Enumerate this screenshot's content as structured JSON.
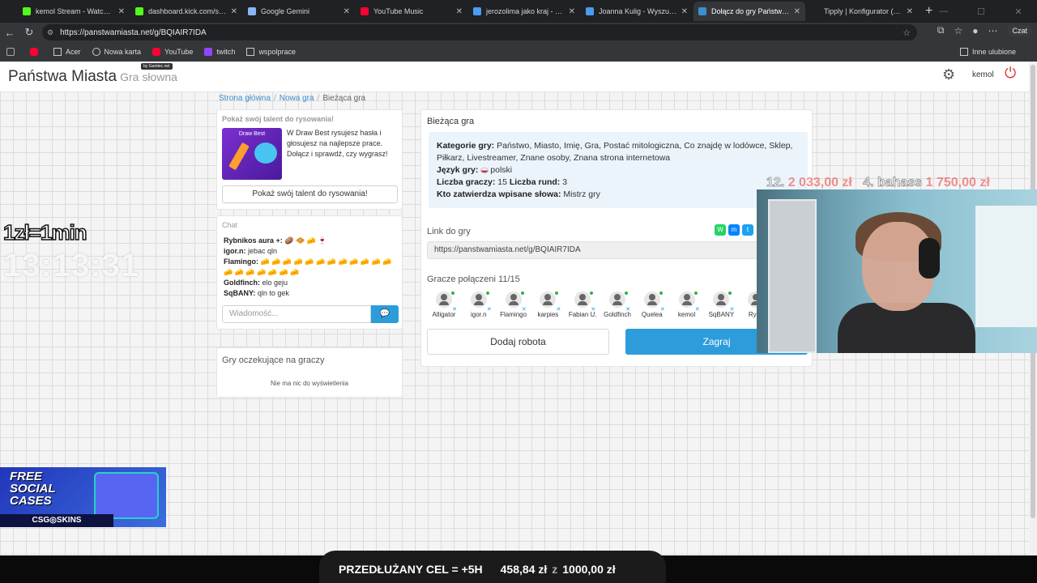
{
  "browser": {
    "tabs": [
      {
        "title": "kemol Stream - Watch Live o",
        "color": "#53fc18",
        "active": false
      },
      {
        "title": "dashboard.kick.com/stream",
        "color": "#53fc18",
        "active": false
      },
      {
        "title": "Google Gemini",
        "color": "#8ab4f8",
        "active": false
      },
      {
        "title": "YouTube Music",
        "color": "#ff0033",
        "active": false
      },
      {
        "title": "jerozolima jako kraj - Wyszu",
        "color": "#4a9cf0",
        "active": false
      },
      {
        "title": "Joanna Kulig - Wyszukaj",
        "color": "#4a9cf0",
        "active": false
      },
      {
        "title": "Dołącz do gry Państwa Miasta",
        "color": "#3b8ed0",
        "active": true
      },
      {
        "title": "Tipply | Konfigurator (Twój o",
        "color": "#222222",
        "active": false
      }
    ],
    "url": "https://panstwamiasta.net/g/BQIAIR7IDA",
    "copilot_label": "Czat",
    "bookmarks": [
      "Acer",
      "Nowa karta",
      "YouTube",
      "twitch",
      "wspolprace"
    ],
    "other_bookmarks": "Inne ulubione"
  },
  "site": {
    "logo": "Państwa Miasta",
    "logo_sub": "Gra słowna",
    "badge": "by Gamtec.net",
    "username": "kemol"
  },
  "breadcrumb": {
    "home": "Strona główna",
    "new_game": "Nowa gra",
    "current": "Bieżąca gra"
  },
  "draw_promo": {
    "title": "Pokaż swój talent do rysowania!",
    "image_caption": "Draw Best",
    "description": "W Draw Best rysujesz hasła i głosujesz na najlepsze prace. Dołącz i sprawdź, czy wygrasz!",
    "button": "Pokaż swój talent do rysowania!"
  },
  "chat": {
    "title": "Chat",
    "messages": [
      {
        "user": "Rybnikos aura +:",
        "text": "🥔 🧇 🧀 🍷"
      },
      {
        "user": "igor.n:",
        "text": "jebac qln"
      },
      {
        "user": "Flamingo:",
        "text": "🧀 🧀 🧀 🧀 🧀 🧀 🧀 🧀 🧀 🧀 🧀 🧀 🧀 🧀 🧀 🧀 🧀 🧀 🧀"
      },
      {
        "user": "Goldfinch:",
        "text": "elo geju"
      },
      {
        "user": "SqBANY:",
        "text": "qln to gek"
      }
    ],
    "input_placeholder": "Wiadomość..."
  },
  "waiting": {
    "title": "Gry oczekujące na graczy",
    "empty": "Nie ma nic do wyświetlenia"
  },
  "game": {
    "title": "Bieżąca gra",
    "categories_label": "Kategorie gry:",
    "categories": "Państwo, Miasto, Imię, Gra, Postać mitologiczna, Co znajdę w lodówce, Sklep, Piłkarz, Livestreamer, Znane osoby, Znana strona internetowa",
    "language_label": "Język gry:",
    "language": "polski",
    "players_count_label": "Liczba graczy:",
    "players_count": "15",
    "rounds_label": "Liczba rund:",
    "rounds": "3",
    "approver_label": "Kto zatwierdza wpisane słowa:",
    "approver": "Mistrz gry",
    "link_label": "Link do gry",
    "link": "https://panstwamiasta.net/g/BQIAIR7IDA",
    "connected_label": "Gracze połączeni 11/15",
    "players": [
      "Alligator",
      "igor.n",
      "Flamingo",
      "karpies",
      "Fabian U.",
      "Goldfinch",
      "Quelea",
      "kemol",
      "SqBANY",
      "Rybn"
    ],
    "add_bot": "Dodaj robota",
    "play": "Zagraj"
  },
  "overlay": {
    "rate": "1zł=1min",
    "timer": "13:13:31",
    "donor1_rank": "12.",
    "donor1_amount": "2 033,00 zł",
    "donor2_name": "4. bahass",
    "donor2_amount": "1 750,00 zł",
    "promo_line1": "FREE",
    "promo_line2": "SOCIAL",
    "promo_line3": "CASES",
    "promo_brand": "CSG◎SKINS",
    "goal_label": "PRZEDŁUŻANY CEL = +5H",
    "goal_current": "458,84 zł",
    "goal_separator": "z",
    "goal_target": "1000,00 zł"
  }
}
